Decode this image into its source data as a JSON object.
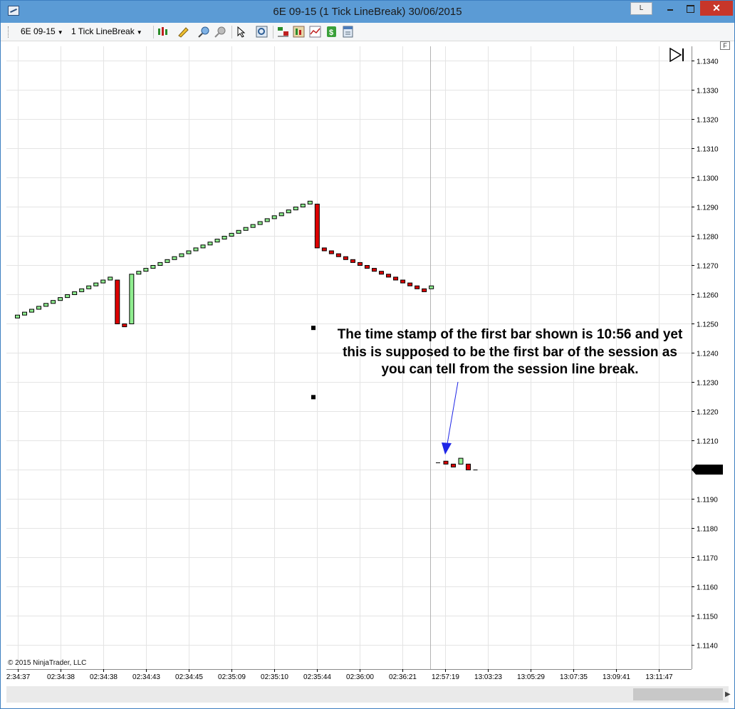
{
  "window": {
    "title": "6E 09-15 (1 Tick LineBreak)  30/06/2015",
    "link_label": "L",
    "close_symbol": "✕"
  },
  "toolbar": {
    "instrument": "6E 09-15",
    "bar_type": "1 Tick LineBreak",
    "icons": [
      "bar-style-icon",
      "drawing-pencil-icon",
      "zoom-in-icon",
      "zoom-out-icon",
      "pointer-icon",
      "magnify-icon",
      "data-box-icon",
      "strategies-icon",
      "indicators-icon",
      "chart-trader-icon",
      "properties-icon"
    ]
  },
  "chart": {
    "copyright": "© 2015 NinjaTrader, LLC",
    "annotation": "The time stamp of the first bar shown is 10:56 and yet this is supposed to be the first bar of the session as you can tell from the session line break.",
    "price_axis_marker": "1.1200",
    "right_panel_label": "F",
    "colors": {
      "up": "#90ee90",
      "down": "#dd0000",
      "grid": "#e4e4e4",
      "arrow": "#1f26e6",
      "session_break": "#b3b3b3"
    }
  },
  "chart_data": {
    "type": "line-break",
    "y_ticks": [
      "1.1340",
      "1.1330",
      "1.1320",
      "1.1310",
      "1.1300",
      "1.1290",
      "1.1280",
      "1.1270",
      "1.1260",
      "1.1250",
      "1.1240",
      "1.1230",
      "1.1220",
      "1.1210",
      "1.1200",
      "1.1190",
      "1.1180",
      "1.1170",
      "1.1160",
      "1.1150",
      "1.1140"
    ],
    "x_ticks": [
      "2:34:37",
      "02:34:38",
      "02:34:38",
      "02:34:43",
      "02:34:45",
      "02:35:09",
      "02:35:10",
      "02:35:44",
      "02:36:00",
      "02:36:21",
      "12:57:19",
      "13:03:23",
      "13:05:29",
      "13:07:35",
      "13:09:41",
      "13:11:47"
    ],
    "ylim": [
      1.1135,
      1.1344
    ],
    "bars": [
      [
        1.1252,
        1.1253,
        "up"
      ],
      [
        1.1253,
        1.1254,
        "up"
      ],
      [
        1.1254,
        1.1255,
        "up"
      ],
      [
        1.1255,
        1.1256,
        "up"
      ],
      [
        1.1256,
        1.1257,
        "up"
      ],
      [
        1.1257,
        1.1258,
        "up"
      ],
      [
        1.1258,
        1.1259,
        "up"
      ],
      [
        1.1259,
        1.126,
        "up"
      ],
      [
        1.126,
        1.1261,
        "up"
      ],
      [
        1.1261,
        1.1262,
        "up"
      ],
      [
        1.1262,
        1.1263,
        "up"
      ],
      [
        1.1263,
        1.1264,
        "up"
      ],
      [
        1.1264,
        1.1265,
        "up"
      ],
      [
        1.1265,
        1.1266,
        "up"
      ],
      [
        1.125,
        1.1265,
        "down"
      ],
      [
        1.1249,
        1.125,
        "down"
      ],
      [
        1.125,
        1.1267,
        "up"
      ],
      [
        1.1267,
        1.1268,
        "up"
      ],
      [
        1.1268,
        1.1269,
        "up"
      ],
      [
        1.1269,
        1.127,
        "up"
      ],
      [
        1.127,
        1.1271,
        "up"
      ],
      [
        1.1271,
        1.1272,
        "up"
      ],
      [
        1.1272,
        1.1273,
        "up"
      ],
      [
        1.1273,
        1.1274,
        "up"
      ],
      [
        1.1274,
        1.1275,
        "up"
      ],
      [
        1.1275,
        1.1276,
        "up"
      ],
      [
        1.1276,
        1.1277,
        "up"
      ],
      [
        1.1277,
        1.1278,
        "up"
      ],
      [
        1.1278,
        1.1279,
        "up"
      ],
      [
        1.1279,
        1.128,
        "up"
      ],
      [
        1.128,
        1.1281,
        "up"
      ],
      [
        1.1281,
        1.1282,
        "up"
      ],
      [
        1.1282,
        1.1283,
        "up"
      ],
      [
        1.1283,
        1.1284,
        "up"
      ],
      [
        1.1284,
        1.1285,
        "up"
      ],
      [
        1.1285,
        1.1286,
        "up"
      ],
      [
        1.1286,
        1.1287,
        "up"
      ],
      [
        1.1287,
        1.1288,
        "up"
      ],
      [
        1.1288,
        1.1289,
        "up"
      ],
      [
        1.1289,
        1.129,
        "up"
      ],
      [
        1.129,
        1.1291,
        "up"
      ],
      [
        1.1291,
        1.1292,
        "up"
      ],
      [
        1.1276,
        1.1291,
        "down"
      ],
      [
        1.1275,
        1.1276,
        "down"
      ],
      [
        1.1274,
        1.1275,
        "down"
      ],
      [
        1.1273,
        1.1274,
        "down"
      ],
      [
        1.1272,
        1.1273,
        "down"
      ],
      [
        1.1271,
        1.1272,
        "down"
      ],
      [
        1.127,
        1.1271,
        "down"
      ],
      [
        1.1269,
        1.127,
        "down"
      ],
      [
        1.1268,
        1.1269,
        "down"
      ],
      [
        1.1267,
        1.1268,
        "down"
      ],
      [
        1.1266,
        1.1267,
        "down"
      ],
      [
        1.1265,
        1.1266,
        "down"
      ],
      [
        1.1264,
        1.1265,
        "down"
      ],
      [
        1.1263,
        1.1264,
        "down"
      ],
      [
        1.1262,
        1.1263,
        "down"
      ],
      [
        1.1261,
        1.1262,
        "down"
      ],
      [
        1.1262,
        1.1263,
        "up"
      ],
      [
        1.12025,
        1.12025,
        "flat"
      ],
      [
        1.1202,
        1.1203,
        "down"
      ],
      [
        1.1201,
        1.1202,
        "down"
      ],
      [
        1.1202,
        1.1204,
        "up"
      ],
      [
        1.12,
        1.1202,
        "down"
      ],
      [
        1.12,
        1.12,
        "flat"
      ]
    ],
    "outlier_points": [
      1.12485,
      1.12248
    ],
    "last_price": 1.12
  }
}
